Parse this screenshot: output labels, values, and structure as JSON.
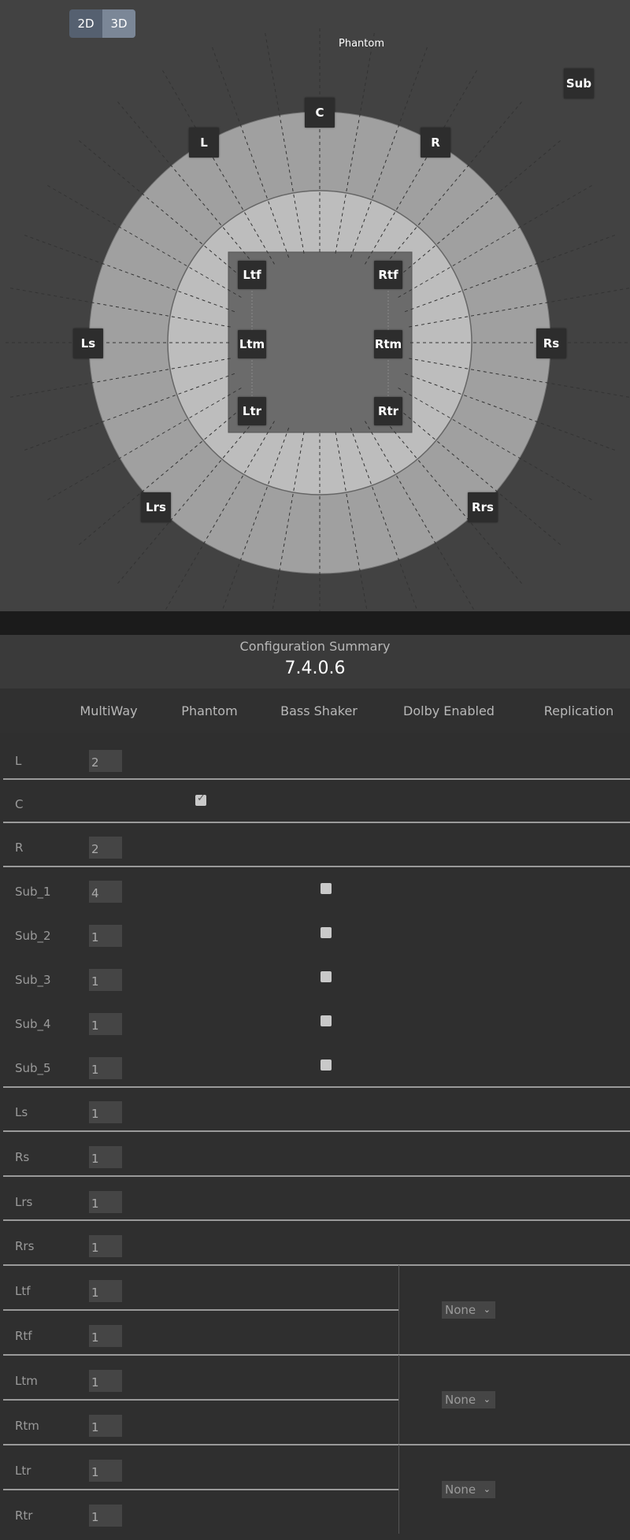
{
  "view_toggle": {
    "options": [
      "2D",
      "3D"
    ],
    "selected": "3D"
  },
  "layout": {
    "phantom_label": "Phantom",
    "speakers": {
      "L": "L",
      "C": "C",
      "R": "R",
      "Sub": "Sub",
      "Ls": "Ls",
      "Rs": "Rs",
      "Lrs": "Lrs",
      "Rrs": "Rrs",
      "Ltf": "Ltf",
      "Rtf": "Rtf",
      "Ltm": "Ltm",
      "Rtm": "Rtm",
      "Ltr": "Ltr",
      "Rtr": "Rtr"
    }
  },
  "summary": {
    "title": "Configuration Summary",
    "version": "7.4.0.6",
    "columns": [
      "MultiWay",
      "Phantom",
      "Bass Shaker",
      "Dolby Enabled",
      "Replication"
    ],
    "rows": [
      {
        "label": "L",
        "multiway": "2"
      },
      {
        "label": "C",
        "multiway": "",
        "phantom": true
      },
      {
        "label": "R",
        "multiway": "2"
      },
      {
        "label": "Sub_1",
        "multiway": "4",
        "bass_shaker": false
      },
      {
        "label": "Sub_2",
        "multiway": "1",
        "bass_shaker": false
      },
      {
        "label": "Sub_3",
        "multiway": "1",
        "bass_shaker": false
      },
      {
        "label": "Sub_4",
        "multiway": "1",
        "bass_shaker": false
      },
      {
        "label": "Sub_5",
        "multiway": "1",
        "bass_shaker": false
      },
      {
        "label": "Ls",
        "multiway": "1"
      },
      {
        "label": "Rs",
        "multiway": "1"
      },
      {
        "label": "Lrs",
        "multiway": "1"
      },
      {
        "label": "Rrs",
        "multiway": "1"
      },
      {
        "label": "Ltf",
        "multiway": "1"
      },
      {
        "label": "Rtf",
        "multiway": "1"
      },
      {
        "label": "Ltm",
        "multiway": "1"
      },
      {
        "label": "Rtm",
        "multiway": "1"
      },
      {
        "label": "Ltr",
        "multiway": "1"
      },
      {
        "label": "Rtr",
        "multiway": "1"
      }
    ],
    "replication": [
      {
        "pair": "Ltf/Rtf",
        "value": "None"
      },
      {
        "pair": "Ltm/Rtm",
        "value": "None"
      },
      {
        "pair": "Ltr/Rtr",
        "value": "None"
      }
    ]
  },
  "colors": {
    "outer_ring": "#a0a0a0",
    "inner_ring": "#bdbdbd",
    "top_square": "#6b6b6b",
    "speaker_box": "#2d2d2d",
    "toggle_active": "#7b8797"
  }
}
